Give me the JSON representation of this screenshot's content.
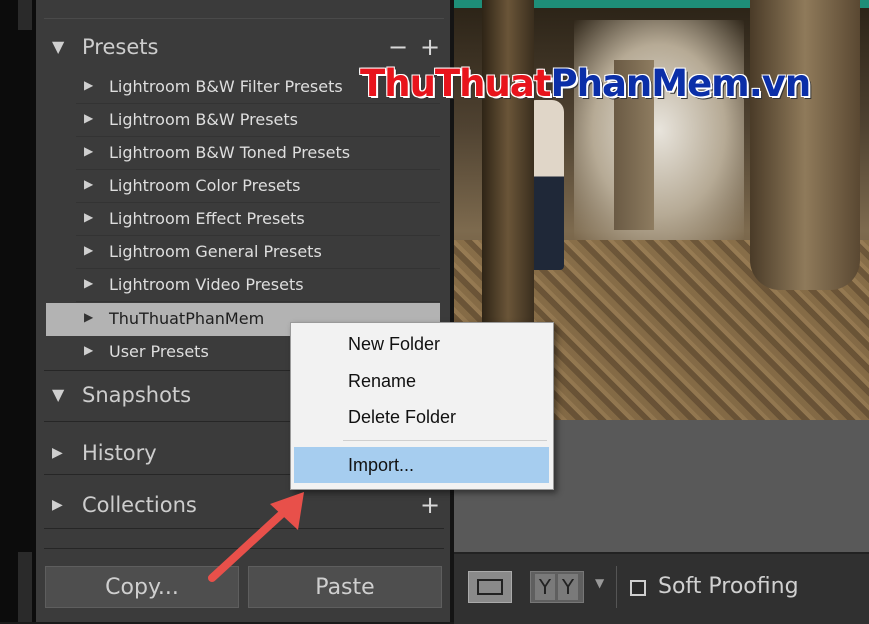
{
  "watermark": {
    "part1": "Thu",
    "part2": "Thuat",
    "part3": "PhanMem",
    "part4": ".vn"
  },
  "panel": {
    "presets": {
      "title": "Presets",
      "minus": "−",
      "plus": "+",
      "items": [
        {
          "label": "Lightroom B&W Filter Presets"
        },
        {
          "label": "Lightroom B&W Presets"
        },
        {
          "label": "Lightroom B&W Toned Presets"
        },
        {
          "label": "Lightroom Color Presets"
        },
        {
          "label": "Lightroom Effect Presets"
        },
        {
          "label": "Lightroom General Presets"
        },
        {
          "label": "Lightroom Video Presets"
        },
        {
          "label": "ThuThuatPhanMem",
          "selected": true
        },
        {
          "label": "User Presets"
        }
      ]
    },
    "snapshots": {
      "title": "Snapshots"
    },
    "history": {
      "title": "History"
    },
    "collections": {
      "title": "Collections",
      "plus": "+"
    },
    "copy_label": "Copy...",
    "paste_label": "Paste"
  },
  "context_menu": {
    "items": [
      "New Folder",
      "Rename",
      "Delete Folder"
    ],
    "import_label": "Import..."
  },
  "toolbar": {
    "yy_left": "Y",
    "yy_right": "Y",
    "soft_proofing_label": "Soft Proofing",
    "soft_proofing_checked": false
  },
  "colors": {
    "arrow": "#e8504a",
    "menu_highlight": "#a6cdef",
    "selected_row": "#b3b3b3"
  }
}
